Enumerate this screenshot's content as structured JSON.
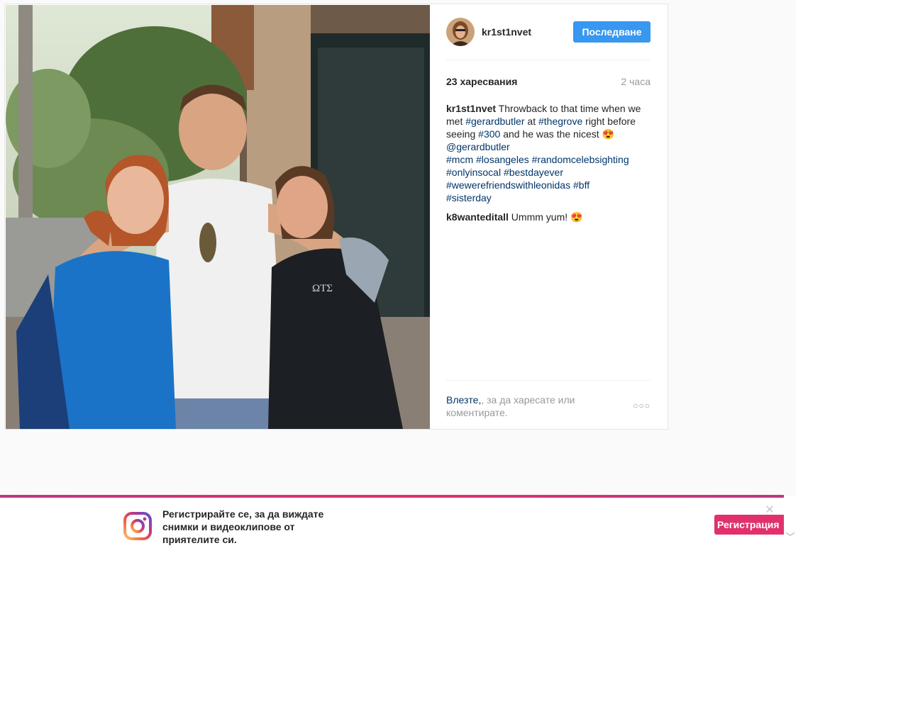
{
  "post": {
    "username": "kr1st1nvet",
    "follow_label": "Последване",
    "likes": "23 харесвания",
    "time": "2 часа",
    "caption": {
      "author": "kr1st1nvet",
      "t1": " Throwback to that time when we met ",
      "h1": "#gerardbutler",
      "t2": " at ",
      "h2": "#thegrove",
      "t3": " right before seeing ",
      "h3": "#300",
      "t4": " and he was the nicest 😍 ",
      "m1": "@gerardbutler",
      "h4": "#mcm",
      "h5": "#losangeles",
      "h6": "#randomcelebsighting",
      "h7": "#onlyinsocal",
      "h8": "#bestdayever",
      "h9": "#wewerefriendswithleonidas",
      "h10": "#bff",
      "h11": "#sisterday"
    },
    "comment2": {
      "author": "k8wanteditall",
      "text": " Ummm yum! 😍"
    },
    "login_link": "Влезте,",
    "login_rest": ", за да харесате или коментирате.",
    "more_label": "○○○"
  },
  "banner": {
    "text": "Регистрирайте се, за да виждате снимки и видеоклипове от приятелите си.",
    "signup_label": "Регистрация",
    "close_label": "✕"
  },
  "scroll_arrow": "﹀",
  "colors": {
    "accent": "#3897f0",
    "link": "#003569",
    "signup": "#e1306c",
    "muted": "#999999"
  }
}
